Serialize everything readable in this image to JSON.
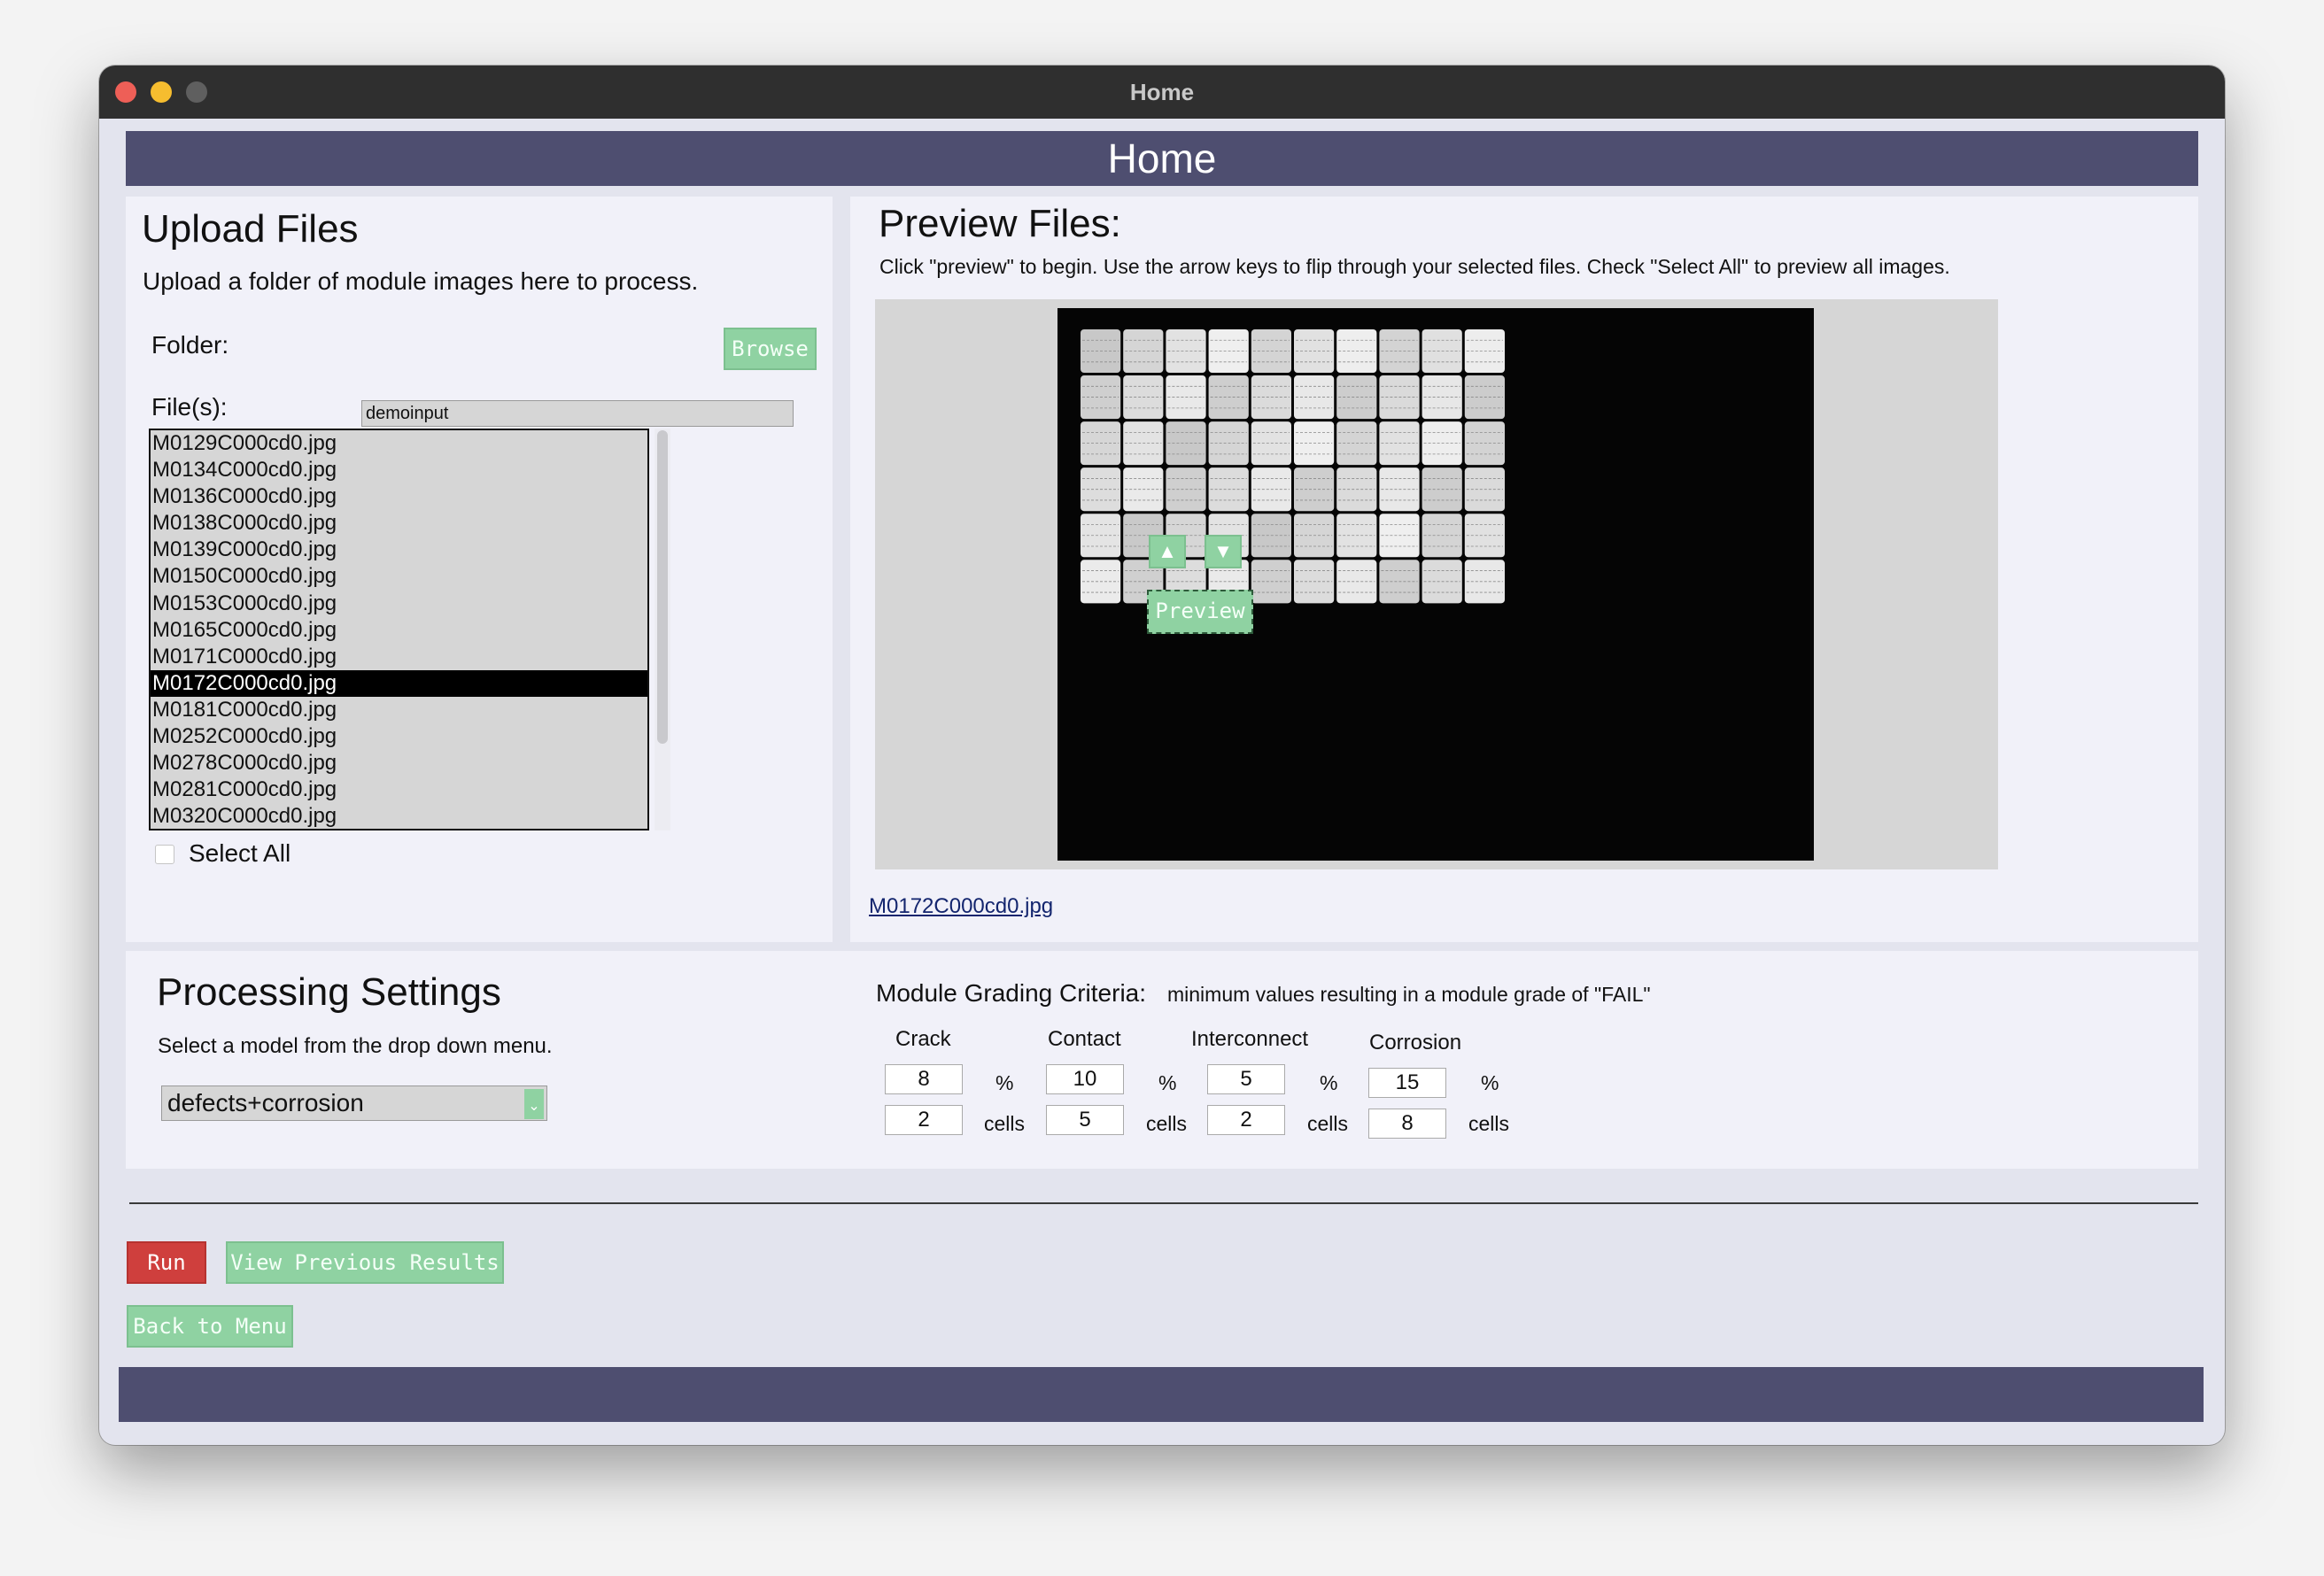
{
  "window": {
    "title": "Home"
  },
  "header": {
    "title": "Home"
  },
  "upload": {
    "title": "Upload Files",
    "description": "Upload a folder of module images here to process.",
    "folder_label": "Folder:",
    "folder_value": "demoinput",
    "browse_label": "Browse",
    "files_label": "File(s):",
    "files": [
      "M0129C000cd0.jpg",
      "M0134C000cd0.jpg",
      "M0136C000cd0.jpg",
      "M0138C000cd0.jpg",
      "M0139C000cd0.jpg",
      "M0150C000cd0.jpg",
      "M0153C000cd0.jpg",
      "M0165C000cd0.jpg",
      "M0171C000cd0.jpg",
      "M0172C000cd0.jpg",
      "M0181C000cd0.jpg",
      "M0252C000cd0.jpg",
      "M0278C000cd0.jpg",
      "M0281C000cd0.jpg",
      "M0320C000cd0.jpg"
    ],
    "selected_file": "M0172C000cd0.jpg",
    "select_all_label": "Select All",
    "select_all_checked": false
  },
  "preview": {
    "title": "Preview Files:",
    "instructions": "Click \"preview\" to begin. Use the arrow keys to flip through your selected files. Check \"Select All\" to preview all images.",
    "up_icon": "▲",
    "down_icon": "▼",
    "preview_button": "Preview",
    "filename_link": "M0172C000cd0.jpg"
  },
  "processing": {
    "title": "Processing Settings",
    "description": "Select a model from the drop down menu.",
    "model_selected": "defects+corrosion"
  },
  "grading": {
    "title": "Module Grading Criteria:",
    "subtitle": "minimum values resulting in a module grade of \"FAIL\"",
    "percent_unit": "%",
    "cells_unit": "cells",
    "criteria": [
      {
        "name": "Crack",
        "percent": "8",
        "cells": "2"
      },
      {
        "name": "Contact",
        "percent": "10",
        "cells": "5"
      },
      {
        "name": "Interconnect",
        "percent": "5",
        "cells": "2"
      },
      {
        "name": "Corrosion",
        "percent": "15",
        "cells": "8"
      }
    ]
  },
  "actions": {
    "run": "Run",
    "view_previous": "View Previous Results",
    "back_to_menu": "Back to Menu"
  },
  "colors": {
    "accent_bar": "#4e4e70",
    "button_green": "#8fd2a2",
    "button_red": "#cf3f3d",
    "panel_bg": "#f1f1f9"
  }
}
